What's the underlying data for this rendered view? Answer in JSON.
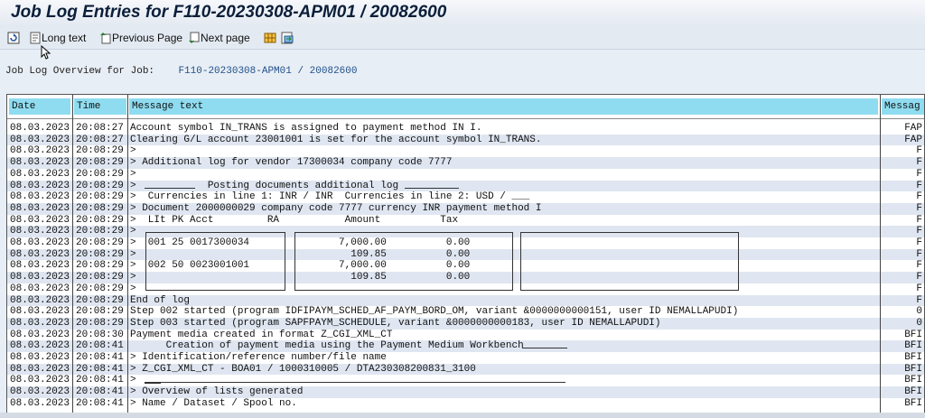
{
  "title": "Job Log Entries for F110-20230308-APM01 / 20082600",
  "toolbar": {
    "long_text": "Long text",
    "previous_page": "Previous Page",
    "next_page": "Next page"
  },
  "overview": {
    "label": "Job Log Overview for Job:",
    "job": "F110-20230308-APM01 / 20082600"
  },
  "columns": {
    "date": "Date",
    "time": "Time",
    "message": "Message text",
    "type": "Messag"
  },
  "rows": [
    {
      "date": "08.03.2023",
      "time": "20:08:27",
      "msg": "Account symbol IN_TRANS is assigned to payment method IN I.",
      "type": "FAP"
    },
    {
      "date": "08.03.2023",
      "time": "20:08:27",
      "msg": "Clearing G/L account 23001001 is set for the account symbol IN_TRANS.",
      "type": "FAP"
    },
    {
      "date": "08.03.2023",
      "time": "20:08:29",
      "msg": ">",
      "type": "F"
    },
    {
      "date": "08.03.2023",
      "time": "20:08:29",
      "msg": "> Additional log for vendor 17300034 company code 7777",
      "type": "F"
    },
    {
      "date": "08.03.2023",
      "time": "20:08:29",
      "msg": ">",
      "type": "F"
    },
    {
      "date": "08.03.2023",
      "time": "20:08:29",
      "msg": ">            Posting documents additional log",
      "type": "F"
    },
    {
      "date": "08.03.2023",
      "time": "20:08:29",
      "msg": ">  Currencies in line 1: INR / INR  Currencies in line 2: USD / ___",
      "type": "F"
    },
    {
      "date": "08.03.2023",
      "time": "20:08:29",
      "msg": "> Document 2000000029 company code 7777 currency INR payment method I",
      "type": "F"
    },
    {
      "date": "08.03.2023",
      "time": "20:08:29",
      "msg": ">  LIt PK Acct         RA           Amount          Tax",
      "type": "F"
    },
    {
      "date": "08.03.2023",
      "time": "20:08:29",
      "msg": ">",
      "type": "F"
    },
    {
      "date": "08.03.2023",
      "time": "20:08:29",
      "msg": ">  001 25 0017300034               7,000.00          0.00",
      "type": "F"
    },
    {
      "date": "08.03.2023",
      "time": "20:08:29",
      "msg": ">                                    109.85          0.00",
      "type": "F"
    },
    {
      "date": "08.03.2023",
      "time": "20:08:29",
      "msg": ">  002 50 0023001001               7,000.00          0.00",
      "type": "F"
    },
    {
      "date": "08.03.2023",
      "time": "20:08:29",
      "msg": ">                                    109.85          0.00",
      "type": "F"
    },
    {
      "date": "08.03.2023",
      "time": "20:08:29",
      "msg": ">",
      "type": "F"
    },
    {
      "date": "08.03.2023",
      "time": "20:08:29",
      "msg": "End of log",
      "type": "F"
    },
    {
      "date": "08.03.2023",
      "time": "20:08:29",
      "msg": "Step 002 started (program IDFIPAYM_SCHED_AF_PAYM_BORD_OM, variant &0000000000151, user ID NEMALLAPUDI)",
      "type": "0"
    },
    {
      "date": "08.03.2023",
      "time": "20:08:29",
      "msg": "Step 003 started (program SAPFPAYM_SCHEDULE, variant &0000000000183, user ID NEMALLAPUDI)",
      "type": "0"
    },
    {
      "date": "08.03.2023",
      "time": "20:08:30",
      "msg": "Payment media created in format Z_CGI_XML_CT",
      "type": "BFI"
    },
    {
      "date": "08.03.2023",
      "time": "20:08:41",
      "msg": "      Creation of payment media using the Payment Medium Workbench",
      "type": "BFI"
    },
    {
      "date": "08.03.2023",
      "time": "20:08:41",
      "msg": "> Identification/reference number/file name",
      "type": "BFI"
    },
    {
      "date": "08.03.2023",
      "time": "20:08:41",
      "msg": "> Z_CGI_XML_CT - BOA01 / 1000310005 / DTA230308200831_3100",
      "type": "BFI"
    },
    {
      "date": "08.03.2023",
      "time": "20:08:41",
      "msg": ">",
      "type": "BFI"
    },
    {
      "date": "08.03.2023",
      "time": "20:08:41",
      "msg": "> Overview of lists generated",
      "type": "BFI"
    },
    {
      "date": "08.03.2023",
      "time": "20:08:41",
      "msg": "> Name / Dataset / Spool no.",
      "type": "BFI"
    }
  ]
}
